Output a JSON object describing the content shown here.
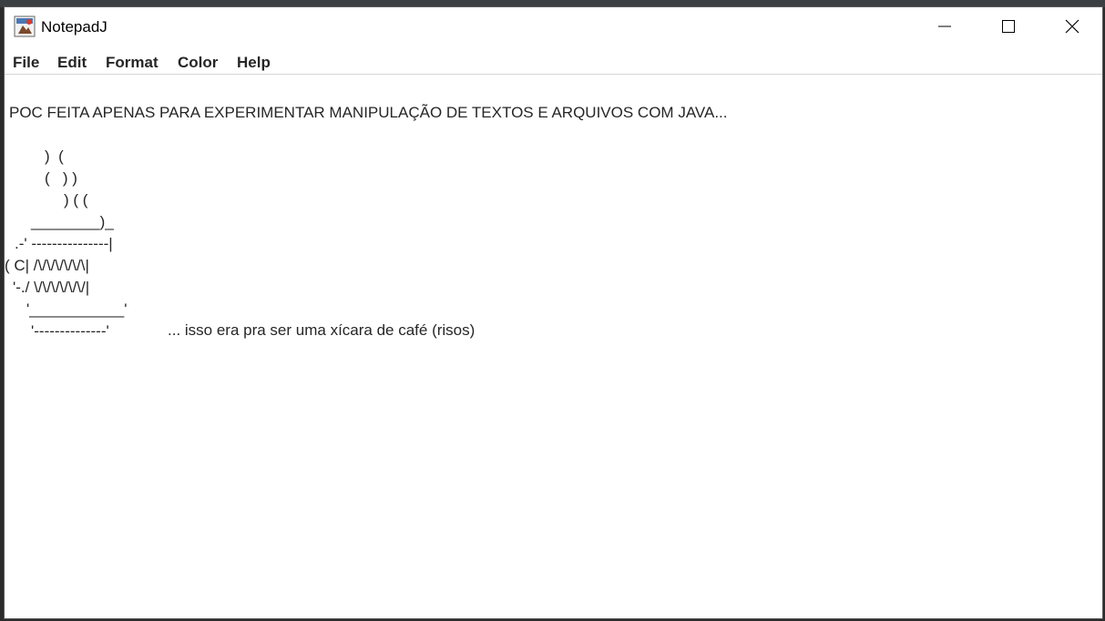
{
  "window": {
    "title": "NotepadJ",
    "controls": {
      "minimize_icon": "minimize-icon",
      "maximize_icon": "maximize-icon",
      "close_icon": "close-icon"
    }
  },
  "menu": {
    "items": [
      "File",
      "Edit",
      "Format",
      "Color",
      "Help"
    ]
  },
  "document": {
    "headline": "POC FEITA APENAS PARA EXPERIMENTAR MANIPULAÇÃO DE TEXTOS E ARQUIVOS COM JAVA...",
    "ascii_art": [
      ")  (",
      "(   ) )",
      ") ( (",
      "________)_",
      ".-' ---------------|",
      "( C| /\\/\\/\\/\\/\\/\\|",
      "'-./ \\/\\/\\/\\/\\/\\/|",
      "'___________'",
      "'--------------'"
    ],
    "caption": "... isso era pra ser uma xícara de café (risos)"
  },
  "colors": {
    "background": "#ffffff",
    "text": "#262626",
    "border": "#5a5a5a"
  }
}
